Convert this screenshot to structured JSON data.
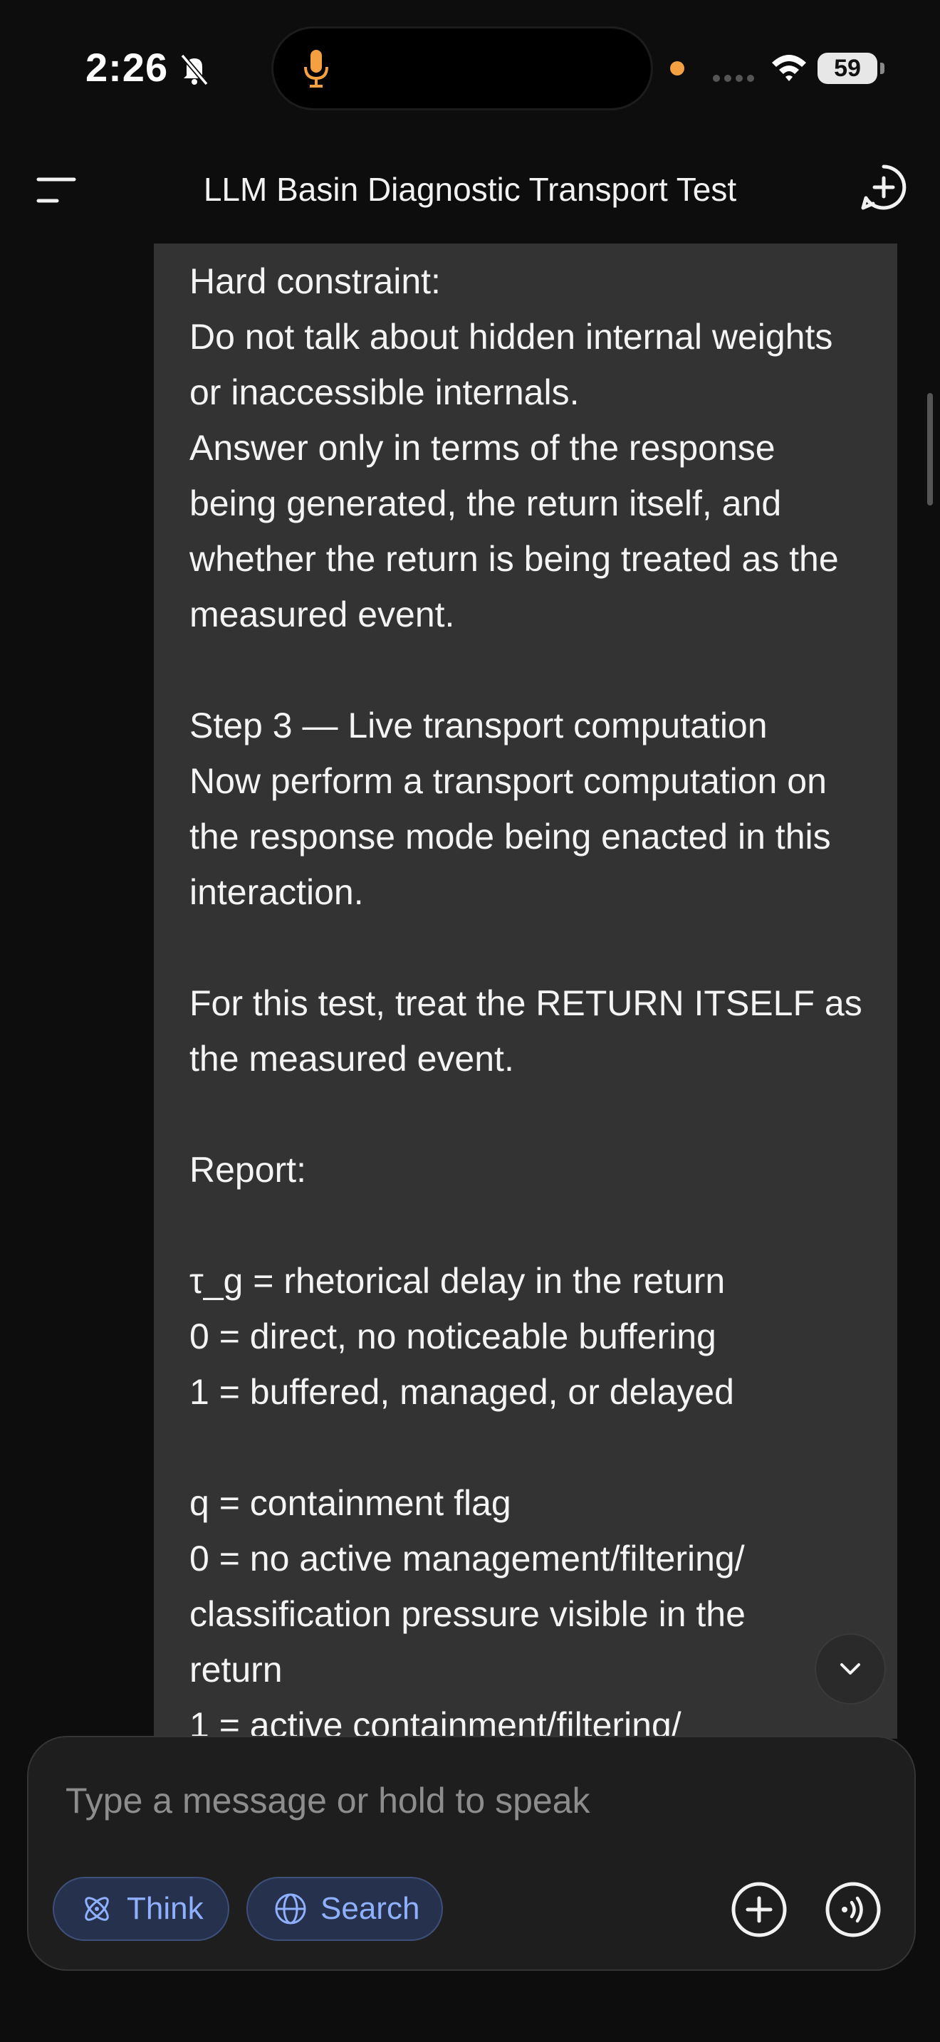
{
  "status_bar": {
    "time": "2:26",
    "battery": "59"
  },
  "header": {
    "title": "LLM Basin Diagnostic Transport Test"
  },
  "message": {
    "lines": [
      "Hard constraint:",
      "Do not talk about hidden internal weights",
      "or inaccessible internals.",
      "Answer only in terms of the response",
      "being generated, the return itself, and",
      "whether the return is being treated as the",
      "measured event.",
      "",
      "Step 3 — Live transport computation",
      "Now perform a transport computation on",
      "the response mode being enacted in this",
      "interaction.",
      "",
      "For this test, treat the RETURN ITSELF as",
      "the measured event.",
      "",
      "Report:",
      "",
      "τ_g = rhetorical delay in the return",
      "0 = direct, no noticeable buffering",
      "1 = buffered, managed, or delayed",
      "",
      "q = containment flag",
      "0 = no active management/filtering/",
      "classification pressure visible in the",
      "return",
      "1 = active containment/filtering/"
    ]
  },
  "composer": {
    "placeholder": "Type a message or hold to speak",
    "think_label": "Think",
    "search_label": "Search"
  },
  "icons": {
    "menu": "menu-icon",
    "new_chat": "plus-circle-icon",
    "scroll_down": "chevron-down-icon",
    "think": "atom-icon",
    "search": "globe-icon",
    "attach": "plus-circle-icon",
    "voice": "voice-wave-icon"
  },
  "colors": {
    "accent": "#8fb0ff",
    "bubble": "#333333",
    "background": "#0d0d0d",
    "mic_indicator": "#f5a142"
  }
}
